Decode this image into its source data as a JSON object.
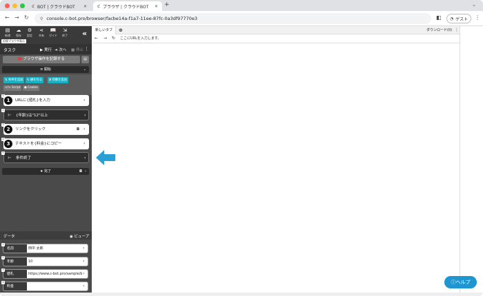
{
  "colors": {
    "accent": "#1ab0c4",
    "help": "#1d96d1",
    "arrow": "#2a9fd6",
    "record": "#e53935"
  },
  "browser": {
    "tabs": [
      {
        "label": "BOT | クラウドBOT",
        "icon": "c-logo-icon"
      },
      {
        "label": "ブラウザ | クラウドBOT",
        "icon": "c-logo-icon"
      }
    ],
    "new_tab": "+",
    "url": "console.c-bot.pro/browser/facbe14a-f1a7-11ee-87fc-0a3df97770e3",
    "profile_label": "ゲスト"
  },
  "sidebar": {
    "icon_buttons": [
      {
        "glyph": "▤",
        "label": "新規"
      },
      {
        "glyph": "☁",
        "label": "保存"
      },
      {
        "glyph": "⚙",
        "label": "設定"
      },
      {
        "glyph": "⋖",
        "label": "共有"
      },
      {
        "glyph": "📖",
        "label": "ガイド"
      },
      {
        "glyph": "⇲",
        "label": "終了"
      }
    ],
    "badge": "旧版ブラウザ表示",
    "task": {
      "title": "タスク",
      "run": "▶ 実行",
      "next": "➜ 次へ",
      "stop": "■ 停止"
    },
    "record_label": "ブラウザ操作を記録する",
    "start_label": "≡ 開始",
    "end_label": "★ 完了",
    "add_buttons": [
      "条件を追加",
      "繰を作る",
      "待機を追加"
    ],
    "sub_buttons": [
      "Script",
      "Cookie"
    ],
    "steps": [
      {
        "num": "1",
        "text": "URLに{値札}を入力",
        "type": "light",
        "idx": "1"
      },
      {
        "sym": "⊢",
        "text": "{年齢}は\"12\"以上",
        "type": "dark",
        "idx": "2"
      },
      {
        "num": "2",
        "text": "リンクをクリック",
        "type": "light",
        "camera": true,
        "idx": "3"
      },
      {
        "num": "3",
        "text": "テキストを{料金}にコピー",
        "type": "light",
        "idx": "4"
      },
      {
        "sym": "⊢",
        "text": "条件終了",
        "type": "dark",
        "idx": "5"
      }
    ],
    "data": {
      "title": "データ",
      "viewer": "◉ ビューア",
      "rows": [
        {
          "key": "名前",
          "value": "田中 太郎",
          "idx": "1"
        },
        {
          "key": "年齢",
          "value": "10",
          "idx": "2"
        },
        {
          "key": "値札",
          "value": "https://www.c-bot.pro/sample/b",
          "idx": "3"
        },
        {
          "key": "料金",
          "value": "",
          "idx": "4"
        }
      ]
    }
  },
  "content": {
    "tab_label": "新しいタブ",
    "add_tab": "⊕",
    "download": "ダウンロード(0)",
    "url_placeholder": "ここにURLを入力します。"
  },
  "help_label": "ⓘヘルプ"
}
